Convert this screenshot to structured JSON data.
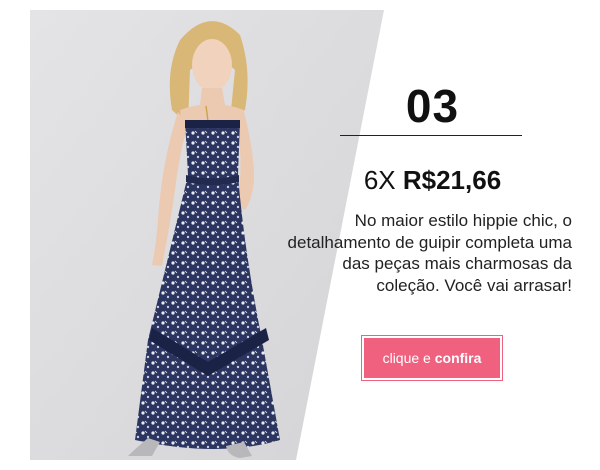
{
  "product": {
    "number": "03",
    "installments": "6X",
    "amount": "R$21,66",
    "description": "No maior estilo hippie chic, o detalhamento de guipir completa uma das peças mais charmosas da coleção. Você vai arrasar!",
    "cta_prefix": "clique e",
    "cta_strong": "confira"
  },
  "colors": {
    "accent": "#f0607f",
    "panel": "#dcdcde",
    "dress": "#2b3560",
    "text": "#111111"
  },
  "image": {
    "subject": "model-in-printed-maxi-dress"
  }
}
